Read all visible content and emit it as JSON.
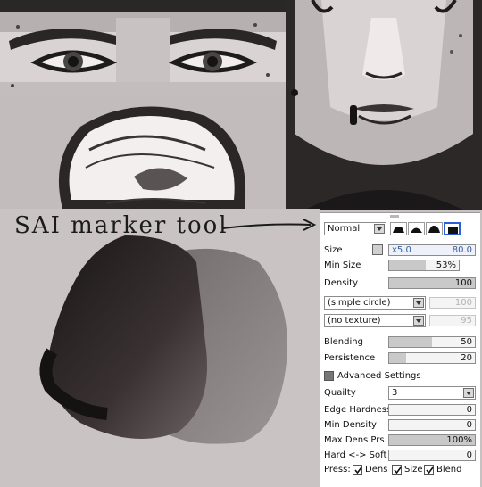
{
  "caption": "SAI marker tool",
  "tool_panel": {
    "blend_mode": "Normal",
    "size": {
      "label": "Size",
      "multiplier": "x5.0",
      "value": "80.0"
    },
    "min_size": {
      "label": "Min Size",
      "value": "53%",
      "level": 0.53
    },
    "density": {
      "label": "Density",
      "value": "100",
      "level": 1.0
    },
    "brush_shape": "(simple circle)",
    "brush_shape_value": "100",
    "texture": "(no texture)",
    "texture_value": "95",
    "blending": {
      "label": "Blending",
      "value": "50",
      "level": 0.5
    },
    "persistence": {
      "label": "Persistence",
      "value": "20",
      "level": 0.2
    },
    "advanced": {
      "header": "Advanced Settings",
      "quality": {
        "label": "Quailty",
        "value": "3"
      },
      "edge_hardness": {
        "label": "Edge Hardness",
        "value": "0",
        "level": 0.0
      },
      "min_density": {
        "label": "Min Density",
        "value": "0",
        "level": 0.0
      },
      "max_dens_prs": {
        "label": "Max Dens Prs.",
        "value": "100%",
        "level": 1.0
      },
      "hard_soft": {
        "label": "Hard <-> Soft",
        "value": "0",
        "level": 0.0
      }
    },
    "press": {
      "label": "Press:",
      "dens": "Dens",
      "size": "Size",
      "blend": "Blend"
    }
  }
}
